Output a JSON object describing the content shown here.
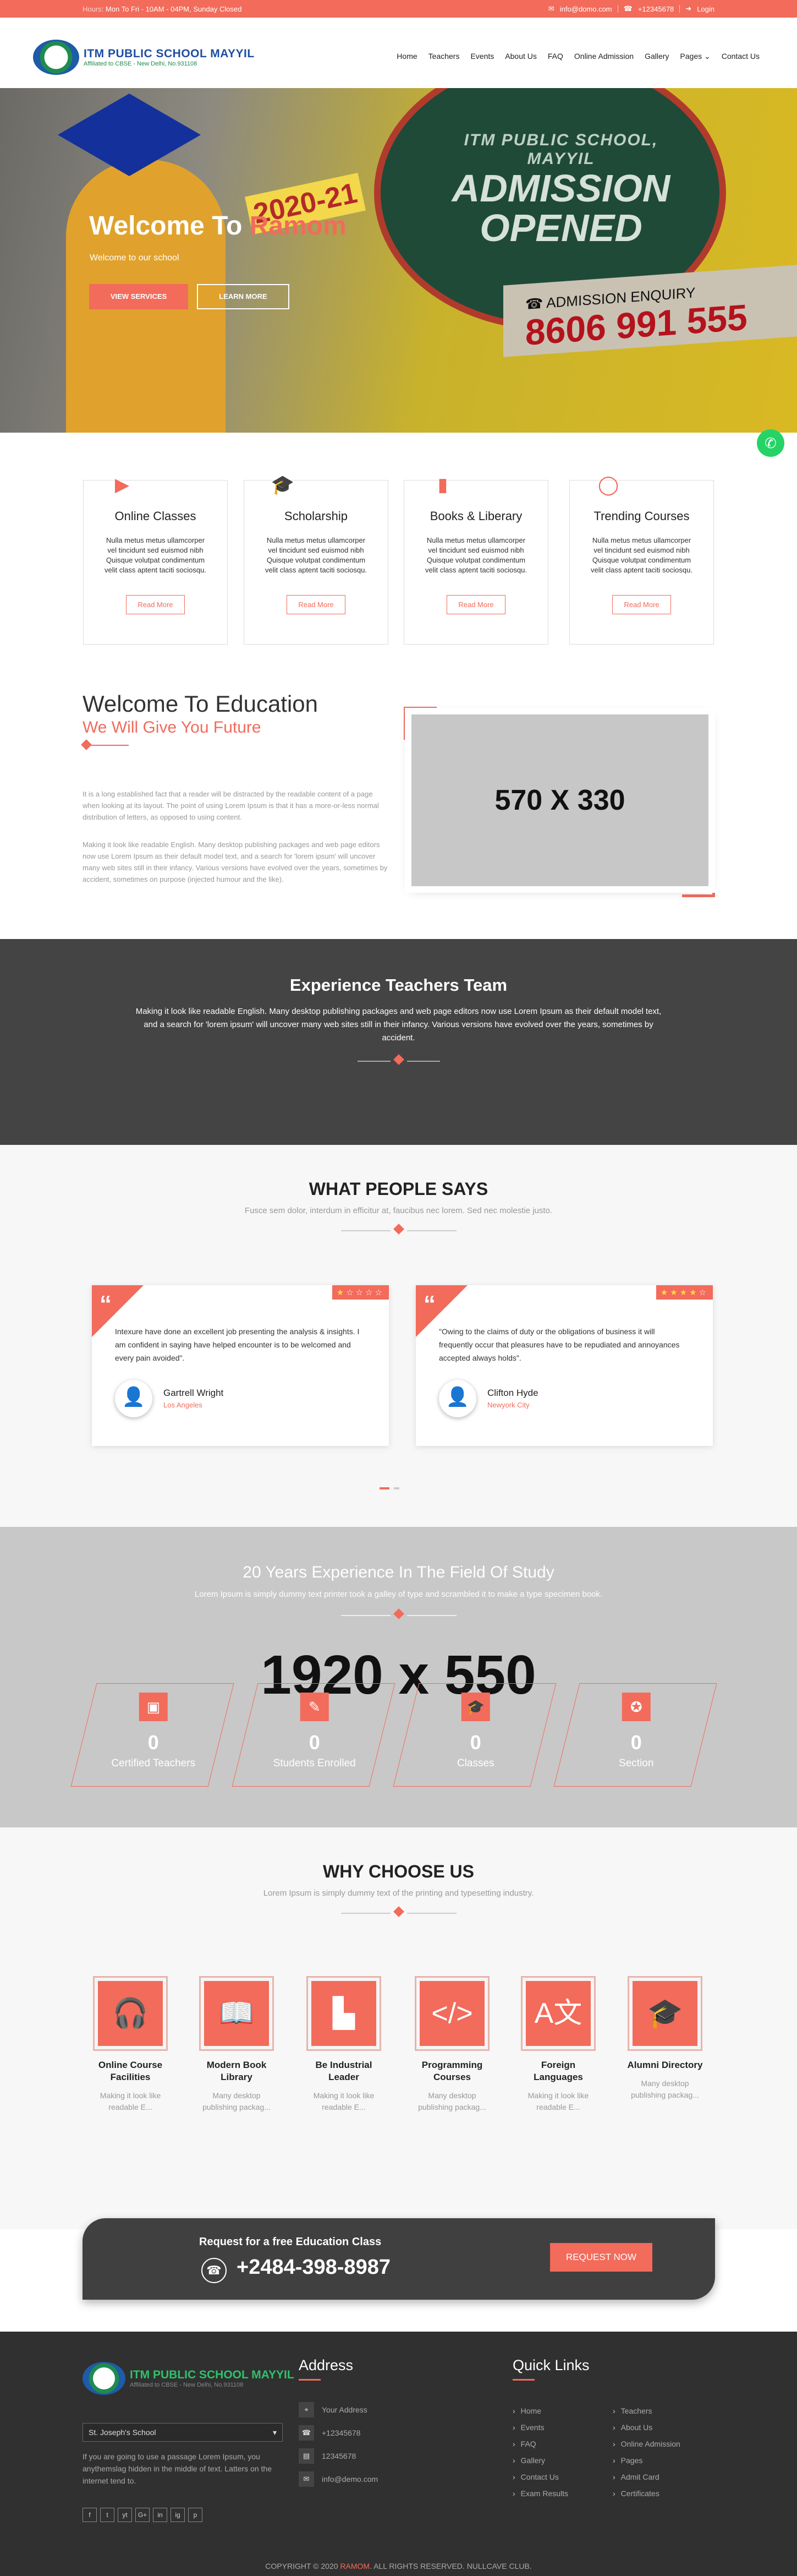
{
  "topbar": {
    "hours_label": "Hours",
    "hours": ": Mon To Fri - 10AM - 04PM, Sunday Closed",
    "email": "info@domo.com",
    "phone": "+12345678",
    "login": "Login"
  },
  "logo": {
    "name": "ITM PUBLIC SCHOOL MAYYIL",
    "affiliation": "Affiliated to CBSE - New Delhi, No.931108"
  },
  "nav": [
    "Home",
    "Teachers",
    "Events",
    "About Us",
    "FAQ",
    "Online Admission",
    "Gallery",
    "Pages",
    "Contact Us"
  ],
  "hero": {
    "title_start": "Welcome To ",
    "title_accent": "Ramom",
    "subtitle": "Welcome to our school",
    "btn_services": "VIEW SERVICES",
    "btn_learn": "LEARN MORE",
    "banner_school": "ITM PUBLIC SCHOOL, MAYYIL",
    "banner_l1": "ADMISSION",
    "banner_l2": "OPENED",
    "banner_year": "2020-21",
    "enquiry_label": "ADMISSION ENQUIRY",
    "enquiry_phone": "8606 991 555"
  },
  "services": [
    {
      "title": "Online Classes",
      "text": "Nulla metus metus ullamcorper vel tincidunt sed euismod nibh Quisque volutpat condimentum velit class aptent taciti sociosqu.",
      "btn": "Read More",
      "icon": "video-camera-icon"
    },
    {
      "title": "Scholarship",
      "text": "Nulla metus metus ullamcorper vel tincidunt sed euismod nibh Quisque volutpat condimentum velit class aptent taciti sociosqu.",
      "btn": "Read More",
      "icon": "graduation-cap-icon"
    },
    {
      "title": "Books & Liberary",
      "text": "Nulla metus metus ullamcorper vel tincidunt sed euismod nibh Quisque volutpat condimentum velit class aptent taciti sociosqu.",
      "btn": "Read More",
      "icon": "book-icon"
    },
    {
      "title": "Trending Courses",
      "text": "Nulla metus metus ullamcorper vel tincidunt sed euismod nibh Quisque volutpat condimentum velit class aptent taciti sociosqu.",
      "btn": "Read More",
      "icon": "chat-bubble-icon"
    }
  ],
  "welcome": {
    "title": "Welcome To Education",
    "subtitle": "We Will Give You Future",
    "p1": "It is a long established fact that a reader will be distracted by the readable content of a page when looking at its layout. The point of using Lorem Ipsum is that it has a more-or-less normal distribution of letters, as opposed to using content.",
    "p2": "Making it look like readable English. Many desktop publishing packages and web page editors now use Lorem Ipsum as their default model text, and a search for 'lorem ipsum' will uncover many web sites still in their infancy. Various versions have evolved over the years, sometimes by accident, sometimes on purpose (injected humour and the like).",
    "image_placeholder": "570 X 330"
  },
  "teachers": {
    "title": "Experience Teachers Team",
    "text": "Making it look like readable English. Many desktop publishing packages and web page editors now use Lorem Ipsum as their default model text, and a search for 'lorem ipsum' will uncover many web sites still in their infancy. Various versions have evolved over the years, sometimes by accident."
  },
  "testimonials": {
    "title": "WHAT PEOPLE SAYS",
    "subtitle": "Fusce sem dolor, interdum in efficitur at, faucibus nec lorem. Sed nec molestie justo.",
    "items": [
      {
        "text": "Intexure have done an excellent job presenting the analysis & insights. I am confident in saying have helped encounter is to be welcomed and every pain avoided\".",
        "name": "Gartrell Wright",
        "location": "Los Angeles",
        "rating": 1,
        "avatar_label": "Photo"
      },
      {
        "text": "\"Owing to the claims of duty or the obligations of business it will frequently occur that pleasures have to be repudiated and annoyances accepted always holds\".",
        "name": "Clifton Hyde",
        "location": "Newyork City",
        "rating": 4,
        "avatar_label": "Photo"
      }
    ]
  },
  "experience": {
    "title": "20 Years Experience In The Field Of Study",
    "subtitle": "Lorem Ipsum is simply dummy text printer took a galley of type and scrambled it to make a type specimen book.",
    "placeholder": "1920 x 550",
    "stats": [
      {
        "num": "0",
        "label": "Certified Teachers",
        "icon": "teacher-icon"
      },
      {
        "num": "0",
        "label": "Students Enrolled",
        "icon": "student-icon"
      },
      {
        "num": "0",
        "label": "Classes",
        "icon": "graduation-cap-icon"
      },
      {
        "num": "0",
        "label": "Section",
        "icon": "award-icon"
      }
    ]
  },
  "why": {
    "title": "WHY CHOOSE US",
    "subtitle": "Lorem Ipsum is simply dummy text of the printing and typesetting industry.",
    "items": [
      {
        "title": "Online Course Facilities",
        "text": "Making it look like readable E...",
        "icon": "headphones-icon"
      },
      {
        "title": "Modern Book Library",
        "text": "Many desktop publishing packag...",
        "icon": "open-book-icon"
      },
      {
        "title": "Be Industrial Leader",
        "text": "Making it look like readable E...",
        "icon": "factory-icon"
      },
      {
        "title": "Programming Courses",
        "text": "Many desktop publishing packag...",
        "icon": "code-icon"
      },
      {
        "title": "Foreign Languages",
        "text": "Making it look like readable E...",
        "icon": "translate-icon"
      },
      {
        "title": "Alumni Directory",
        "text": "Many desktop publishing packag...",
        "icon": "graduate-icon"
      }
    ]
  },
  "cta": {
    "title": "Request for a free Education Class",
    "phone": "+2484-398-8987",
    "btn": "REQUEST NOW"
  },
  "footer": {
    "branch_select": "St. Joseph's School",
    "desc": "If you are going to use a passage Lorem Ipsum, you anythemslag hidden in the middle of text. Latters on the internet tend to.",
    "social": [
      "f",
      "t",
      "yt",
      "G+",
      "in",
      "ig",
      "p"
    ],
    "address_title": "Address",
    "address": [
      "Your Address",
      "+12345678",
      "12345678",
      "info@demo.com"
    ],
    "links_title": "Quick Links",
    "links_col1": [
      "Home",
      "Events",
      "FAQ",
      "Gallery",
      "Contact Us",
      "Exam Results"
    ],
    "links_col2": [
      "Teachers",
      "About Us",
      "Online Admission",
      "Pages",
      "Admit Card",
      "Certificates"
    ],
    "copyright_pre": "COPYRIGHT © 2020 ",
    "copyright_brand": "RAMOM",
    "copyright_post": ". ALL RIGHTS RESERVED. NULLCAVE CLUB."
  },
  "colors": {
    "accent": "#f26b5b",
    "dark": "#444444",
    "footer": "#303030"
  }
}
